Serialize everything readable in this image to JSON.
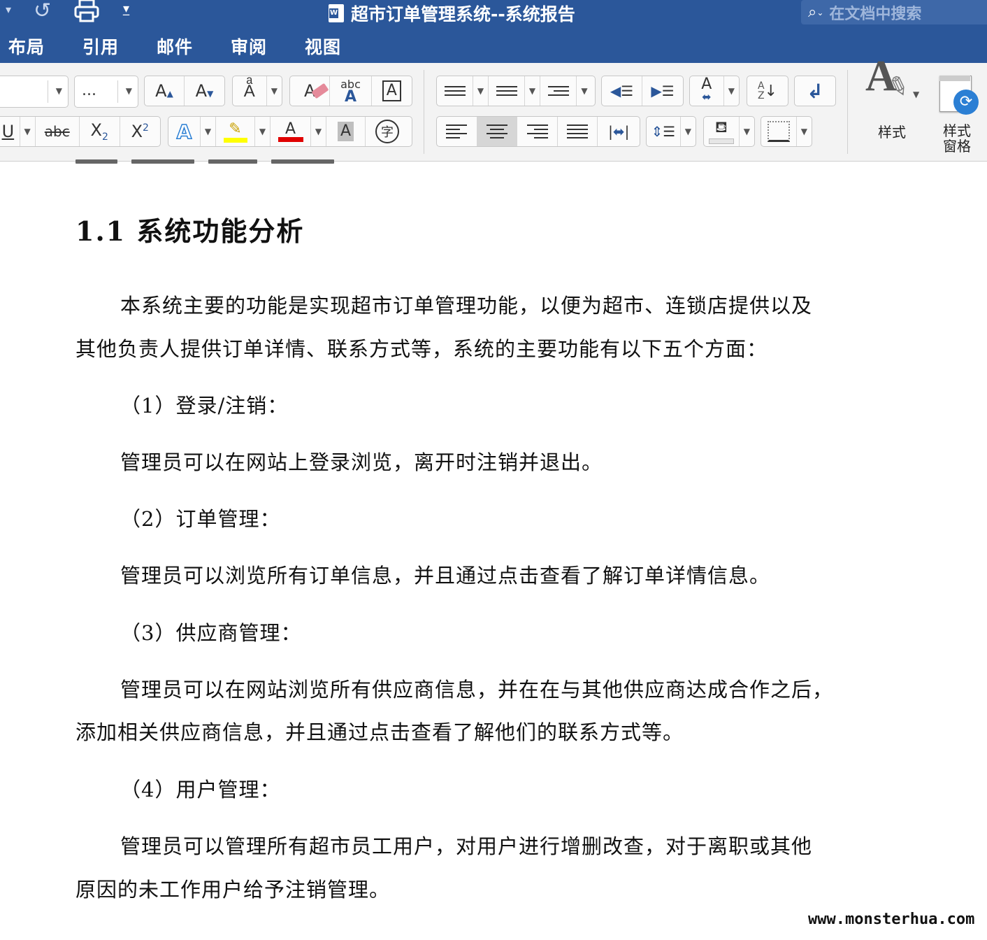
{
  "window": {
    "title": "超市订单管理系统--系统报告",
    "search_placeholder": "在文档中搜索"
  },
  "ribbon_tabs": [
    "布局",
    "引用",
    "邮件",
    "审阅",
    "视图"
  ],
  "ribbon": {
    "font_size_value": "...",
    "styles_label": "样式",
    "styles_pane_label_1": "样式",
    "styles_pane_label_2": "窗格",
    "colors": {
      "highlight": "#ffff00",
      "font_color": "#e00000",
      "accent": "#2b579a"
    }
  },
  "document": {
    "heading": "1.1  系统功能分析",
    "paragraphs": [
      "本系统主要的功能是实现超市订单管理功能，以便为超市、连锁店提供以及",
      "其他负责人提供订单详情、联系方式等，系统的主要功能有以下五个方面：",
      "（1）登录/注销：",
      "管理员可以在网站上登录浏览，离开时注销并退出。",
      "（2）订单管理：",
      "管理员可以浏览所有订单信息，并且通过点击查看了解订单详情信息。",
      "（3）供应商管理：",
      "管理员可以在网站浏览所有供应商信息，并在在与其他供应商达成合作之后，",
      "添加相关供应商信息，并且通过点击查看了解他们的联系方式等。",
      "（4）用户管理：",
      "管理员可以管理所有超市员工用户，对用户进行增删改查，对于离职或其他",
      "原因的未工作用户给予注销管理。"
    ]
  },
  "watermark": "www.monsterhua.com"
}
